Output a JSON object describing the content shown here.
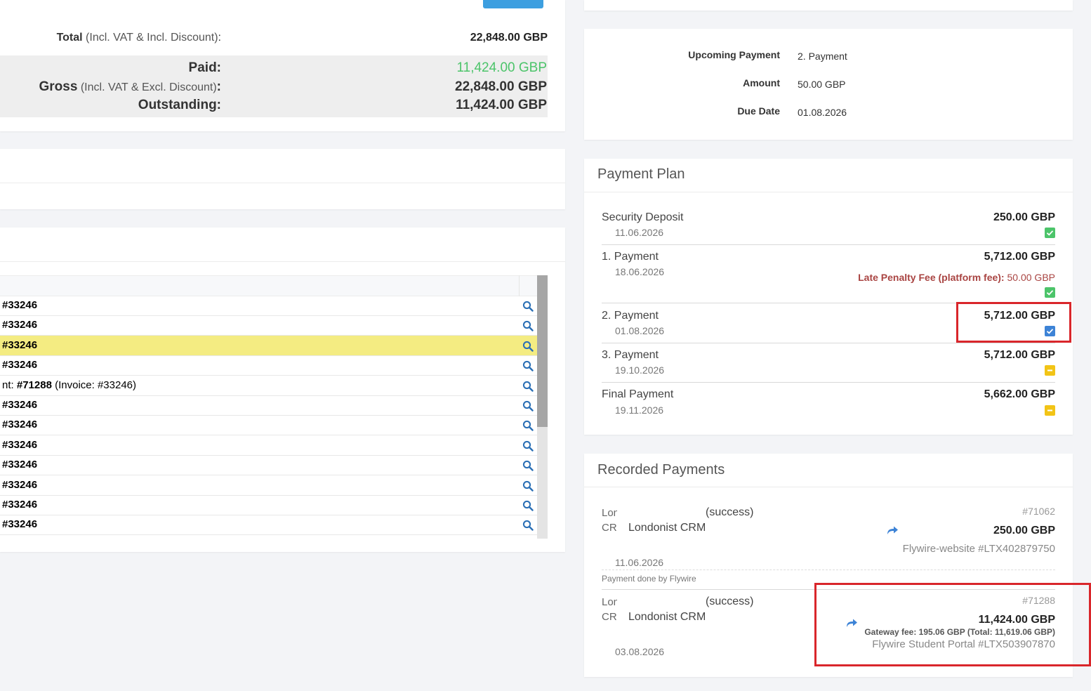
{
  "totals": {
    "total_label": "Total",
    "total_sub": "(Incl. VAT & Incl. Discount)",
    "colon": ":",
    "total_value": "22,848.00 GBP",
    "paid_label": "Paid:",
    "paid_value": "11,424.00 GBP",
    "gross_label": "Gross",
    "gross_sub": "(Incl. VAT & Excl. Discount)",
    "gross_value": "22,848.00 GBP",
    "outstanding_label": "Outstanding:",
    "outstanding_value": "11,424.00 GBP"
  },
  "list": {
    "rows": [
      {
        "text": "#33246"
      },
      {
        "text": "#33246"
      },
      {
        "text": "#33246"
      },
      {
        "text": "#33246"
      },
      {
        "text_prefix": "nt:",
        "text_bold": "#71288",
        "text_suffix": "(Invoice: #33246)"
      },
      {
        "text": "#33246"
      },
      {
        "text": "#33246"
      },
      {
        "text": "#33246"
      },
      {
        "text": "#33246"
      },
      {
        "text": "#33246"
      },
      {
        "text": "#33246"
      },
      {
        "text": "#33246"
      }
    ],
    "highlighted_row": 3
  },
  "upcoming": {
    "upcoming_label": "Upcoming Payment",
    "upcoming_value": "2. Payment",
    "amount_label": "Amount",
    "amount_value": "50.00 GBP",
    "due_label": "Due Date",
    "due_value": "01.08.2026"
  },
  "payment_plan": {
    "title": "Payment Plan",
    "items": [
      {
        "name": "Security Deposit",
        "date": "11.06.2026",
        "amount": "250.00 GBP",
        "status": "paid"
      },
      {
        "name": "1. Payment",
        "date": "18.06.2026",
        "amount": "5,712.00 GBP",
        "penalty_label": "Late Penalty Fee (platform fee):",
        "penalty_value": "50.00 GBP",
        "status": "paid"
      },
      {
        "name": "2. Payment",
        "date": "01.08.2026",
        "amount": "5,712.00 GBP",
        "status": "selected"
      },
      {
        "name": "3. Payment",
        "date": "19.10.2026",
        "amount": "5,712.00 GBP",
        "status": "pending"
      },
      {
        "name": "Final Payment",
        "date": "19.11.2026",
        "amount": "5,662.00 GBP",
        "status": "pending"
      }
    ]
  },
  "recorded": {
    "title": "Recorded Payments",
    "items": [
      {
        "img_alt": "Londonist CRM",
        "name": "Londonist CRM",
        "status": "(success)",
        "date": "11.06.2026",
        "id": "#71062",
        "amount": "250.00 GBP",
        "method": "Flywire-website #LTX402879750",
        "note": "Payment done by Flywire"
      },
      {
        "img_alt": "Londonist CRM",
        "name": "Londonist CRM",
        "status": "(success)",
        "date": "03.08.2026",
        "id": "#71288",
        "amount": "11,424.00 GBP",
        "gateway": "Gateway fee: 195.06 GBP (Total: 11,619.06 GBP)",
        "method": "Flywire Student Portal #LTX503907870"
      }
    ]
  },
  "colors": {
    "paid_green": "#4cc46a",
    "accent_blue": "#3d83d6",
    "pending_yellow": "#f2c416",
    "highlight_row": "#f4ec82",
    "penalty_red": "#a94442",
    "annotation_red": "#d9262b"
  }
}
